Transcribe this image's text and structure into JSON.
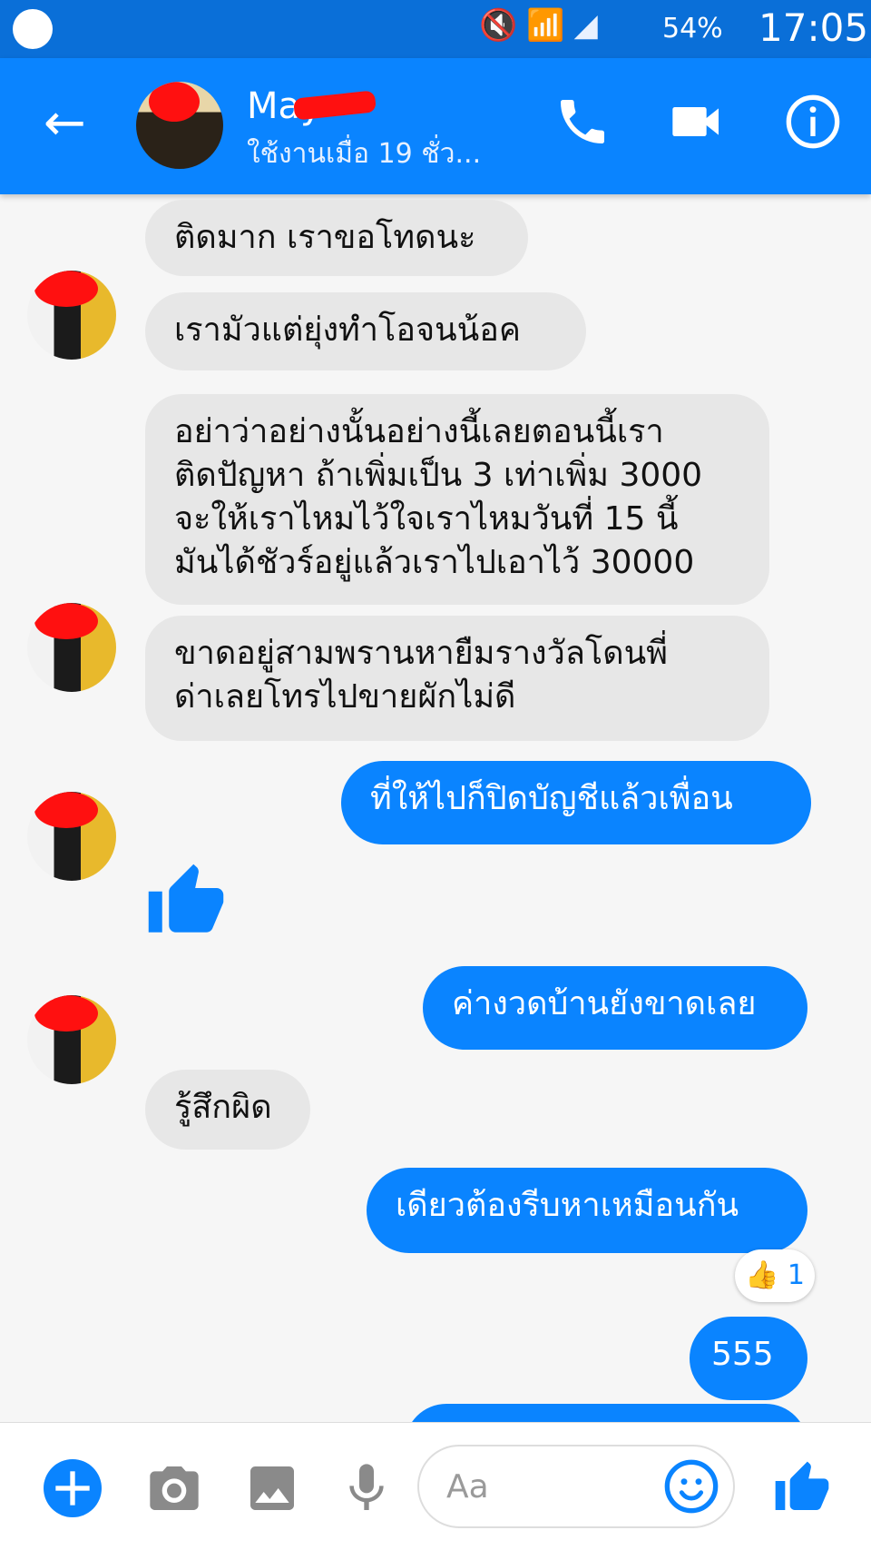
{
  "status_bar": {
    "battery": "54%",
    "time": "17:05"
  },
  "header": {
    "contact_name": "May",
    "status": "ใช้งานเมื่อ 19 ชั่ว..."
  },
  "messages": [
    {
      "dir": "in",
      "text": "ติดมาก เราขอโทดนะ"
    },
    {
      "dir": "in",
      "text": "เรามัวแต่ยุ่งทำโอจนน้อค"
    },
    {
      "dir": "in",
      "text": "อย่าว่าอย่างนั้นอย่างนี้เลยตอนนี้เรา\nติดปัญหา ถ้าเพิ่มเป็น 3 เท่าเพิ่ม 3000\nจะให้เราไหมไว้ใจเราไหมวันที่ 15 นี้\nมันได้ชัวร์อยู่แล้วเราไปเอาไว้ 30000"
    },
    {
      "dir": "in",
      "text": "ขาดอยู่สามพรานหายืมรางวัลโดนพี่\nด่าเลยโทรไปขายผักไม่ดี"
    },
    {
      "dir": "out",
      "text": "ที่ให้ไปก็ปิดบัญชีแล้วเพื่อน"
    },
    {
      "dir": "in",
      "type": "like"
    },
    {
      "dir": "out",
      "text": "ค่างวดบ้านยังขาดเลย"
    },
    {
      "dir": "in",
      "text": "รู้สึกผิด"
    },
    {
      "dir": "out",
      "text": "เดียวต้องรีบหาเหมือนกัน",
      "reaction_count": "1"
    },
    {
      "dir": "out",
      "text": "555"
    }
  ],
  "composer": {
    "placeholder": "Aa"
  },
  "colors": {
    "messenger_blue": "#0a84ff",
    "incoming_bubble": "#e7e7e7"
  }
}
